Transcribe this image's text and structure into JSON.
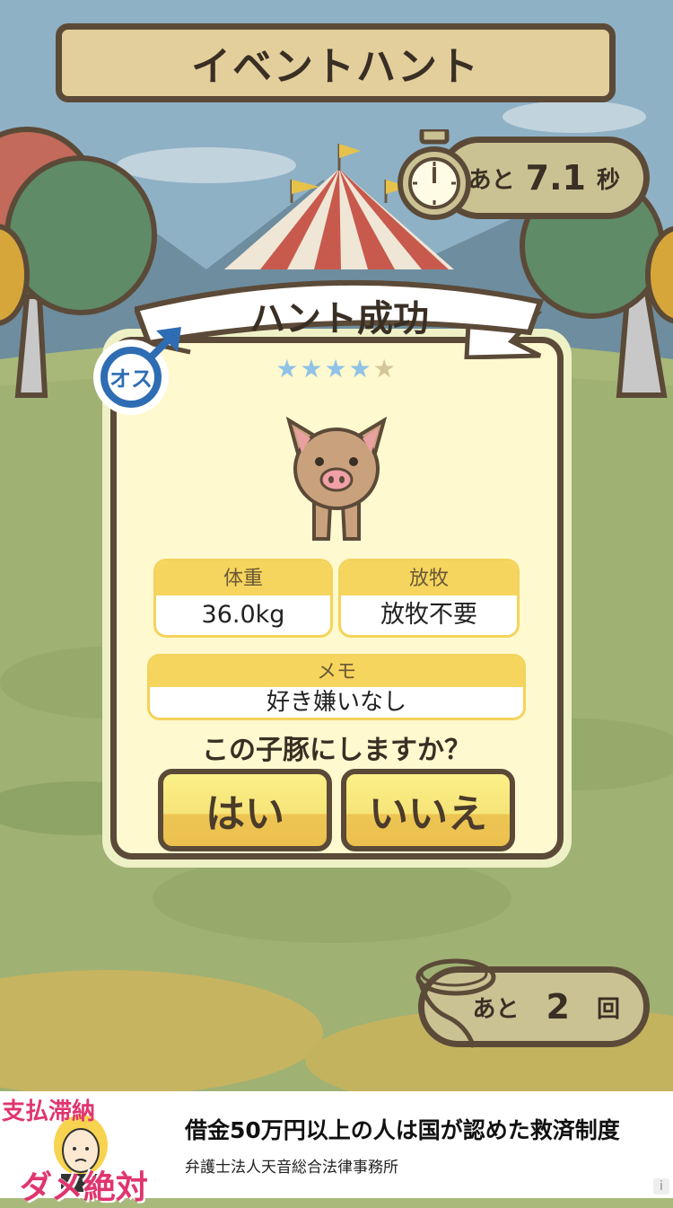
{
  "header": {
    "title": "イベントハント"
  },
  "timer": {
    "prefix": "あと",
    "value": "7.1",
    "unit": "秒"
  },
  "result": {
    "title": "ハント成功",
    "gender_label": "オス",
    "stars": {
      "filled": 4,
      "total": 5
    },
    "weight": {
      "label": "体重",
      "value": "36.0kg"
    },
    "pasture": {
      "label": "放牧",
      "value": "放牧不要"
    },
    "memo": {
      "label": "メモ",
      "value": "好き嫌いなし"
    },
    "question": "この子豚にしますか？",
    "yes_label": "はい",
    "no_label": "いいえ"
  },
  "attempts": {
    "prefix": "あと",
    "value": "2",
    "unit": "回"
  },
  "ad": {
    "thumb_top": "支払滞納",
    "thumb_bottom": "ダメ絶対",
    "title": "借金50万円以上の人は国が認めた救済制度",
    "sponsor": "弁護士法人天音総合法律事務所",
    "info_icon": "i"
  },
  "colors": {
    "border": "#5b4a38",
    "panel": "#fff9cf",
    "accent_yellow": "#f6d55e",
    "gender_blue": "#2e6db4"
  }
}
